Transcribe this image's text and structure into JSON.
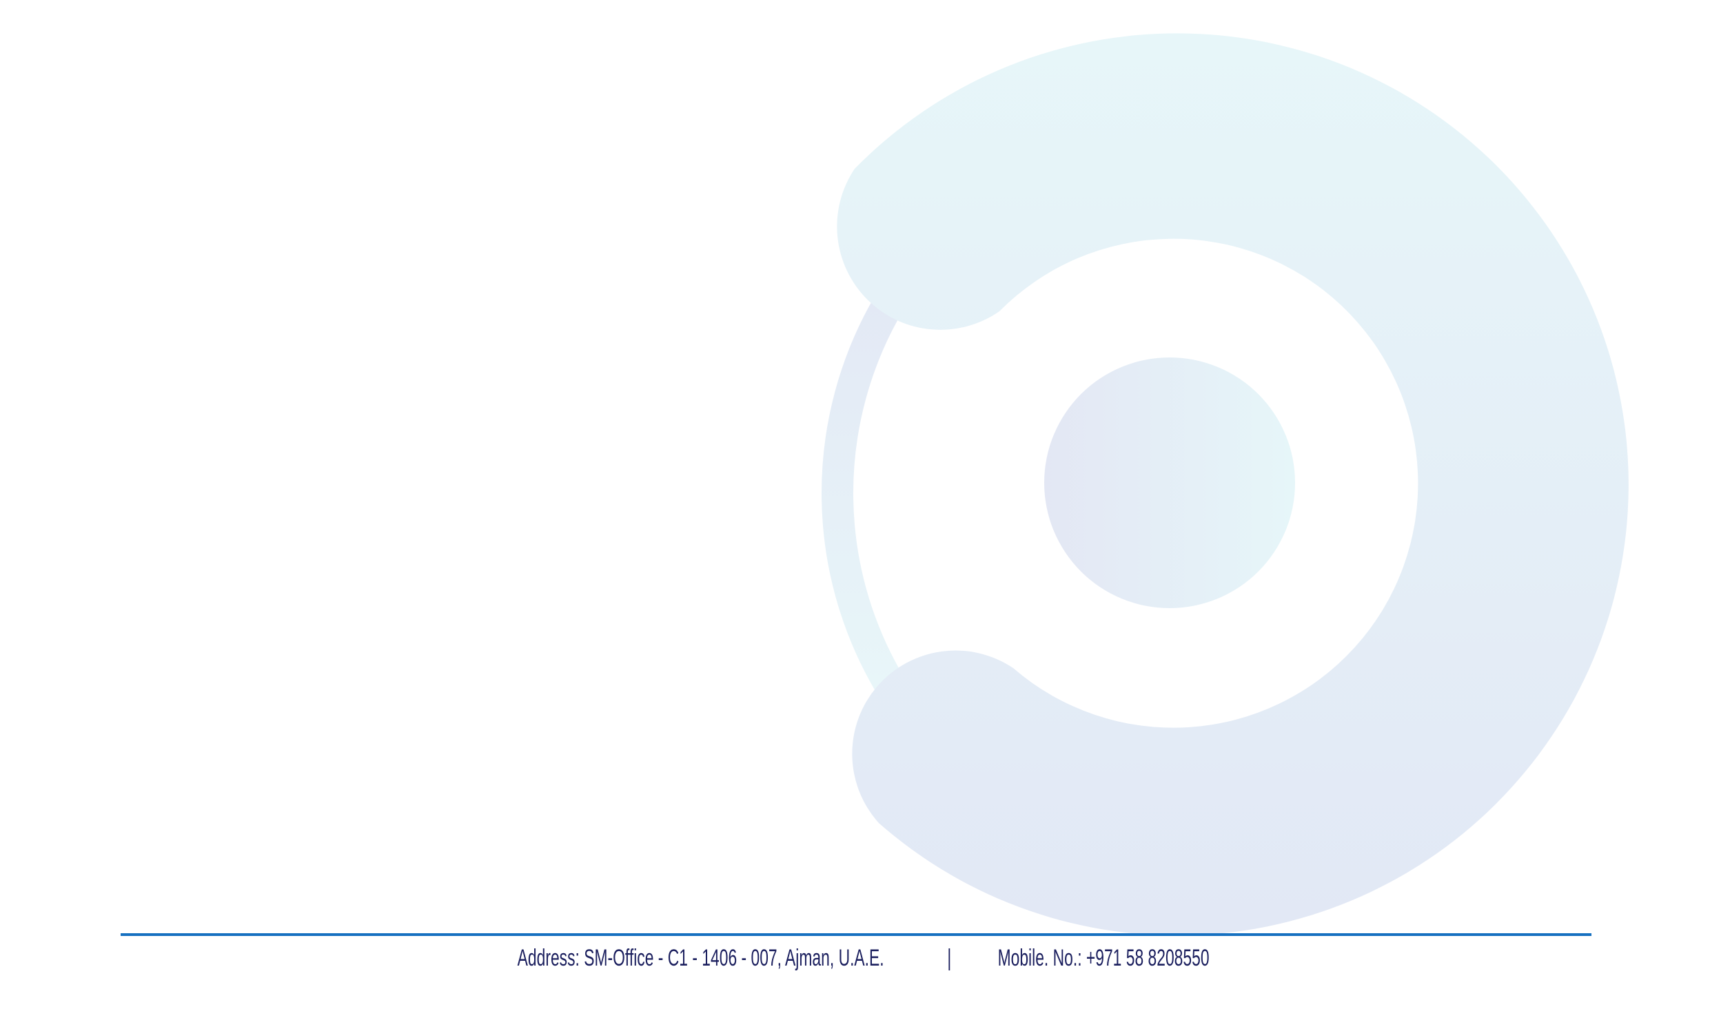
{
  "background": {
    "logo": "circular-o-mark-watermark",
    "colors": {
      "teal_tint": "#e7f6f8",
      "blue_tint": "#e3e9f5"
    }
  },
  "footer": {
    "address": "Address: SM-Office - C1 - 1406 - 007, Ajman, U.A.E.",
    "separator": "|",
    "mobile": "Mobile. No.: +971 58 8208550",
    "rule_color": "#1670c0",
    "text_color": "#1b1f5e"
  }
}
